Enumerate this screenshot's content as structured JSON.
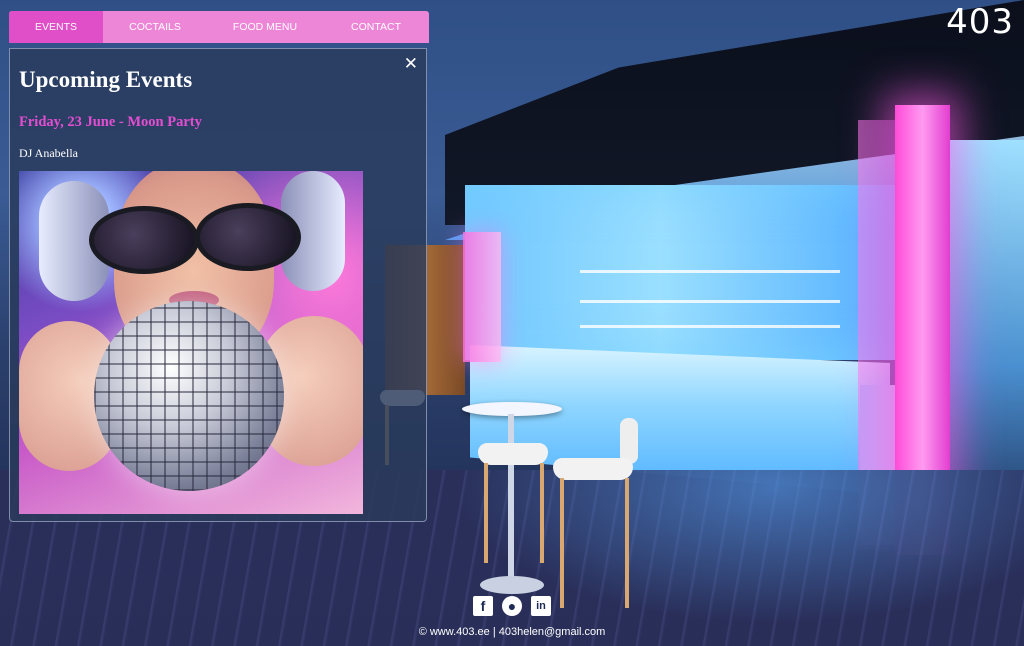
{
  "site_code": "403",
  "nav": {
    "items": [
      {
        "label": "EVENTS",
        "active": true
      },
      {
        "label": "COCTAILS",
        "active": false
      },
      {
        "label": "FOOD MENU",
        "active": false
      },
      {
        "label": "CONTACT",
        "active": false
      }
    ]
  },
  "panel": {
    "title": "Upcoming Events",
    "close_symbol": "✕",
    "event": {
      "title": "Friday, 23 June - Moon Party",
      "performer": "DJ Anabella",
      "image": "dj-girl-with-disco-ball"
    }
  },
  "social": {
    "icons": [
      {
        "name": "facebook-icon",
        "glyph": "f"
      },
      {
        "name": "github-icon",
        "glyph": "●"
      },
      {
        "name": "linkedin-icon",
        "glyph": "in"
      }
    ]
  },
  "footer": {
    "text": "© www.403.ee | 403helen@gmail.com"
  },
  "colors": {
    "nav_bg": "#ee86d8",
    "nav_active": "#e04fc8",
    "event_title": "#e34ed1",
    "panel_bg": "rgba(42,58,92,.82)"
  }
}
